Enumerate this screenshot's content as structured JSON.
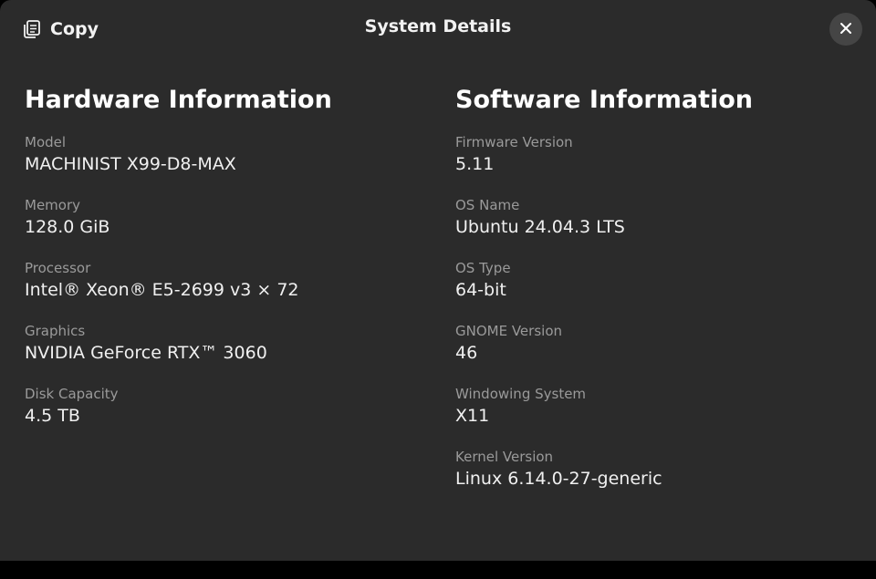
{
  "header": {
    "copy_label": "Copy",
    "title": "System Details",
    "copy_icon": "copy-icon",
    "close_icon": "close-icon"
  },
  "hardware": {
    "title": "Hardware Information",
    "rows": [
      {
        "label": "Model",
        "value": "MACHINIST X99-D8-MAX"
      },
      {
        "label": "Memory",
        "value": "128.0 GiB"
      },
      {
        "label": "Processor",
        "value": "Intel® Xeon® E5-2699 v3 × 72"
      },
      {
        "label": "Graphics",
        "value": "NVIDIA GeForce RTX™ 3060"
      },
      {
        "label": "Disk Capacity",
        "value": "4.5 TB"
      }
    ]
  },
  "software": {
    "title": "Software Information",
    "rows": [
      {
        "label": "Firmware Version",
        "value": "5.11"
      },
      {
        "label": "OS Name",
        "value": "Ubuntu 24.04.3 LTS"
      },
      {
        "label": "OS Type",
        "value": "64-bit"
      },
      {
        "label": "GNOME Version",
        "value": "46"
      },
      {
        "label": "Windowing System",
        "value": "X11"
      },
      {
        "label": "Kernel Version",
        "value": "Linux 6.14.0-27-generic"
      }
    ]
  },
  "colors": {
    "dialog_background": "#2b2b2b",
    "label": "#9a9a9a",
    "value": "#f0f0f0",
    "close_button_background": "#454545"
  }
}
